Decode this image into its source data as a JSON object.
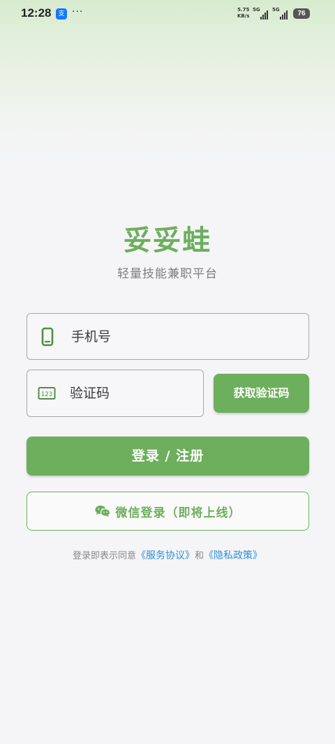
{
  "status_bar": {
    "time": "12:28",
    "app_notification_glyph": "支",
    "more": "···",
    "net_speed_value": "5.75",
    "net_speed_unit": "KB/s",
    "signal_1_label": "5G",
    "signal_2_label": "5G",
    "battery": "76"
  },
  "header": {
    "title": "妥妥蛙",
    "subtitle": "轻量技能兼职平台"
  },
  "form": {
    "phone_placeholder": "手机号",
    "code_placeholder": "验证码",
    "code_icon_text": "123",
    "get_code_label": "获取验证码",
    "login_label": "登录 / 注册",
    "wechat_label": "微信登录（即将上线）"
  },
  "agreement": {
    "prefix": "登录即表示同意",
    "service_link": "《服务协议》",
    "conjunction": "和",
    "privacy_link": "《隐私政策》"
  },
  "colors": {
    "brand_green": "#6daf5c",
    "link_blue": "#2f8fd6",
    "background": "#f5f5f8"
  },
  "icons": {
    "phone": "phone-icon",
    "code": "code-icon",
    "wechat": "wechat-icon"
  }
}
